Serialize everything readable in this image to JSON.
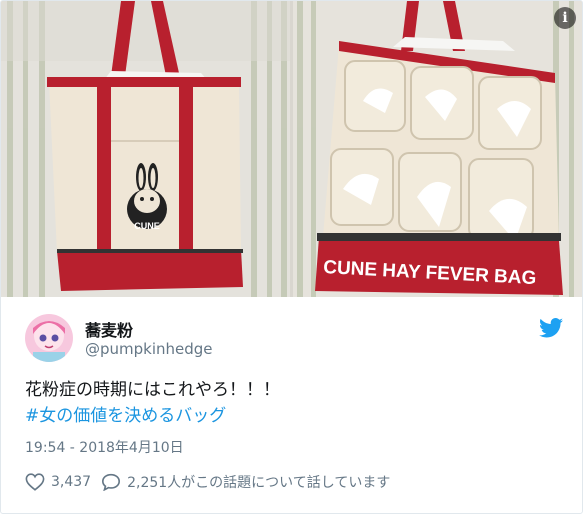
{
  "tweet": {
    "display_name": "蕎麦粉",
    "handle": "@pumpkinhedge",
    "text_line1": "花粉症の時期にはこれやろ！！！",
    "hashtag": "#女の価値を決めるバッグ",
    "timestamp": "19:54 - 2018年4月10日",
    "likes": "3,437",
    "replies_text": "2,251人がこの話題について話しています"
  },
  "photos": {
    "left_brand": "CUNE",
    "right_banner": "CUNE HAY FEVER BAG"
  },
  "icons": {
    "info": "info-icon",
    "twitter": "twitter-bird-icon",
    "like": "heart-icon",
    "reply": "speech-bubble-icon"
  },
  "colors": {
    "accent": "#1da1f2",
    "hashtag": "#1b95e0",
    "bag_red": "#b8202e",
    "canvas": "#efe6d6"
  }
}
